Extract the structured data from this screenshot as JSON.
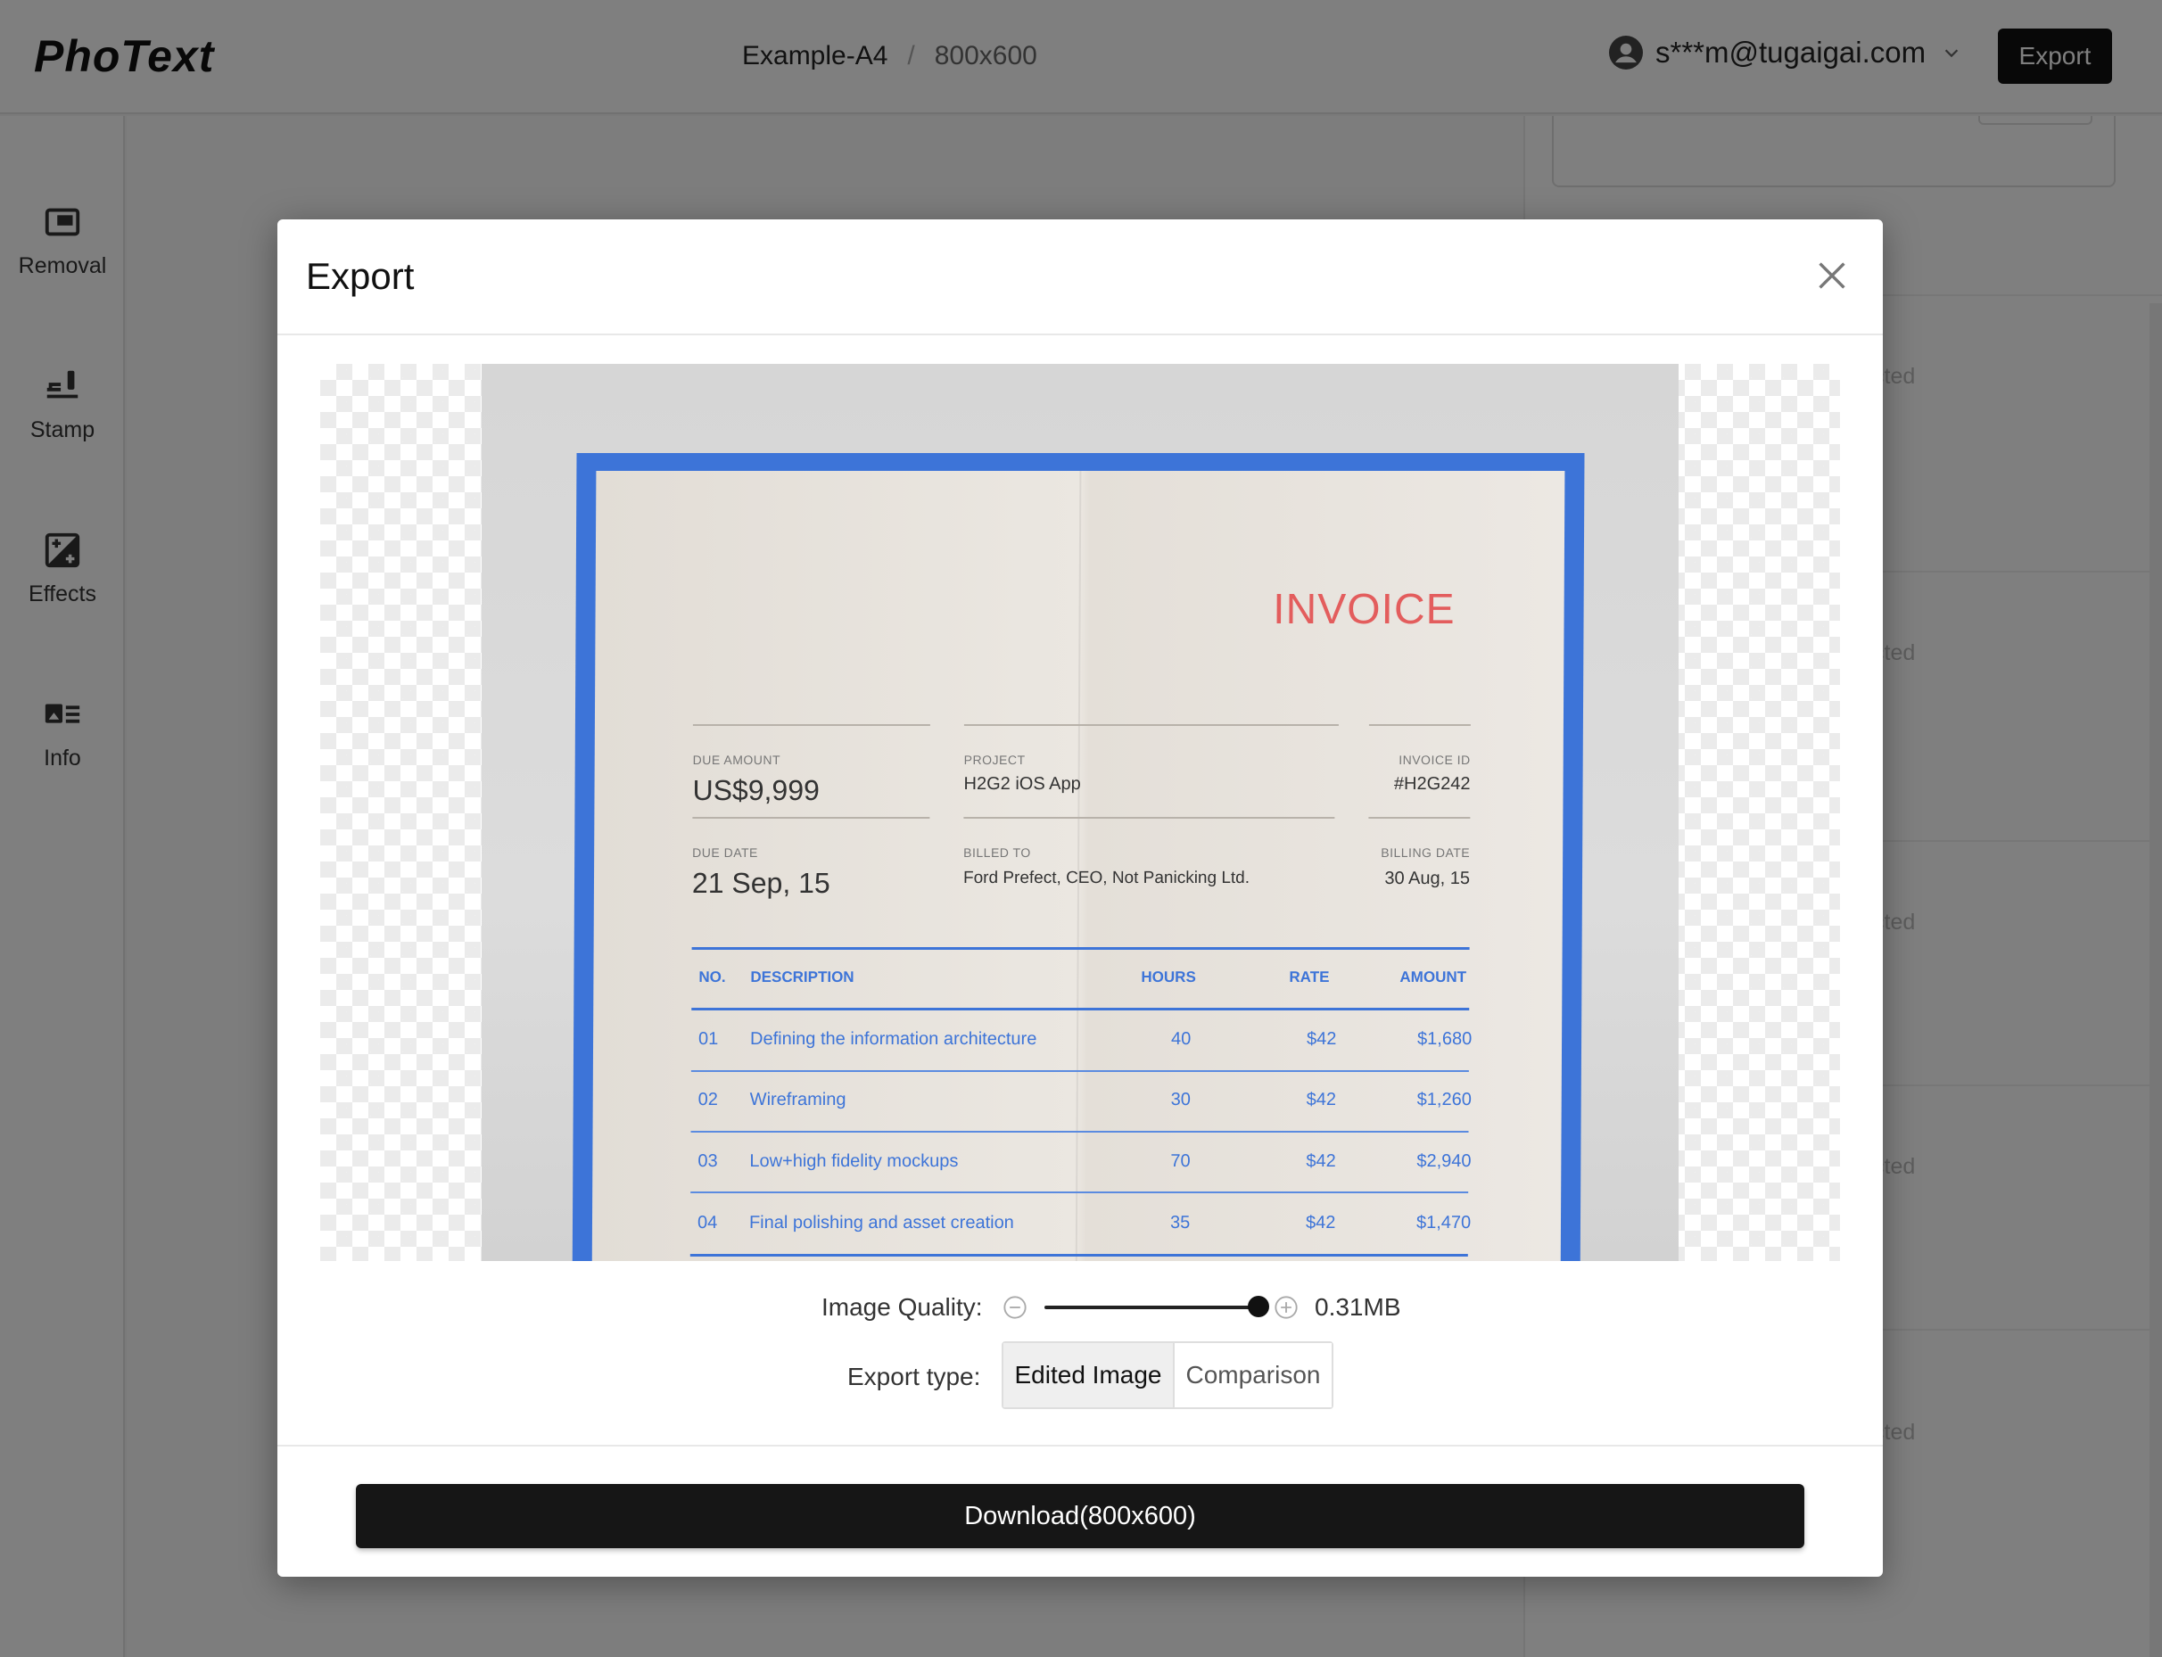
{
  "app": {
    "logo": "PhoText",
    "breadcrumb": {
      "project": "Example-A4",
      "separator": "/",
      "size": "800x600"
    },
    "account": {
      "email": "s***m@tugaigai.com"
    },
    "export_label": "Export"
  },
  "sidebar": {
    "items": [
      {
        "label": "Removal",
        "icon": "removal-icon"
      },
      {
        "label": "Stamp",
        "icon": "stamp-icon"
      },
      {
        "label": "Effects",
        "icon": "effects-icon"
      },
      {
        "label": "Info",
        "icon": "info-icon"
      }
    ]
  },
  "right_panel": {
    "items": [
      {
        "label": "cted"
      },
      {
        "label": "cted"
      },
      {
        "label": "cted"
      },
      {
        "label": "cted"
      },
      {
        "label": "cted"
      }
    ]
  },
  "modal": {
    "title": "Export",
    "quality": {
      "label": "Image Quality:",
      "size": "0.31MB",
      "level": 1.0
    },
    "export_type": {
      "label": "Export type:",
      "options": [
        "Edited Image",
        "Comparison"
      ],
      "selected": "Edited Image"
    },
    "download_label": "Download(800x600)"
  },
  "invoice": {
    "title": "INVOICE",
    "due_amount_label": "DUE AMOUNT",
    "due_amount": "US$9,999",
    "project_label": "PROJECT",
    "project": "H2G2 iOS App",
    "invoice_id_label": "INVOICE ID",
    "invoice_id": "#H2G242",
    "due_date_label": "DUE DATE",
    "due_date": "21 Sep, 15",
    "billed_to_label": "BILLED TO",
    "billed_to": "Ford Prefect, CEO, Not Panicking Ltd.",
    "billing_date_label": "BILLING DATE",
    "billing_date": "30 Aug, 15",
    "columns": {
      "no": "NO.",
      "description": "DESCRIPTION",
      "hours": "HOURS",
      "rate": "RATE",
      "amount": "AMOUNT"
    },
    "rows": [
      {
        "no": "01",
        "description": "Defining the information architecture",
        "hours": "40",
        "rate": "$42",
        "amount": "$1,680"
      },
      {
        "no": "02",
        "description": "Wireframing",
        "hours": "30",
        "rate": "$42",
        "amount": "$1,260"
      },
      {
        "no": "03",
        "description": "Low+high fidelity mockups",
        "hours": "70",
        "rate": "$42",
        "amount": "$2,940"
      },
      {
        "no": "04",
        "description": "Final polishing and asset creation",
        "hours": "35",
        "rate": "$42",
        "amount": "$1,470"
      }
    ]
  },
  "colors": {
    "invoice_blue": "#3d74d8",
    "invoice_red": "#e35d5d",
    "primary_button": "#161616"
  }
}
